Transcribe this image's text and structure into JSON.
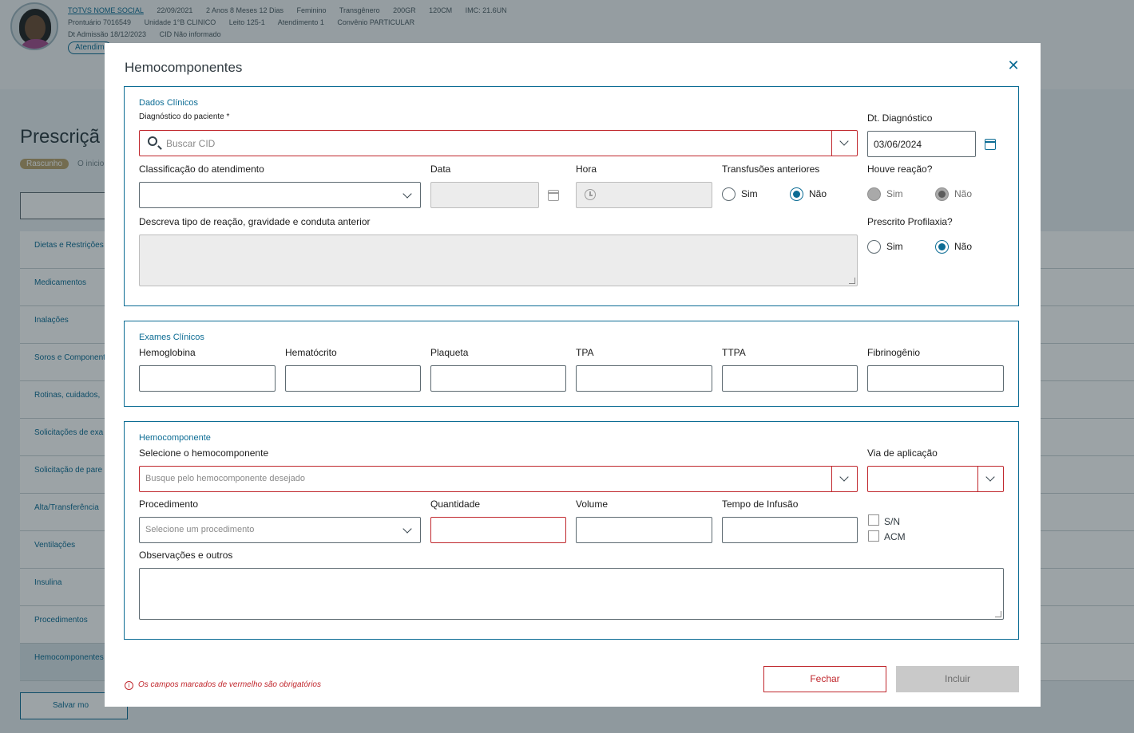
{
  "background": {
    "patient": {
      "name_link": "TOTVS NOME SOCIAL",
      "birth_date": "22/09/2021",
      "age": "2 Anos 8 Meses 12 Dias",
      "sex": "Feminino",
      "gender": "Transgênero",
      "weight": "200GR",
      "height": "120CM",
      "imc": "IMC: 21.6UN",
      "prontuario": "Prontuário 7016549",
      "unidade": "Unidade 1°B CLINICO",
      "leito": "Leito 125-1",
      "atendimento": "Atendimento 1",
      "convenio": "Convênio PARTICULAR",
      "admissao": "Dt Admissão 18/12/2023",
      "cid": "CID Não informado",
      "pill": "Atendim"
    },
    "page_title": "Prescriçã",
    "draft_badge": "Rascunho",
    "draft_note": "O inicio",
    "sidebar_items": [
      "Dietas e Restrições",
      "Medicamentos",
      "Inalações",
      "Soros e Componentes",
      "Rotinas, cuidados,",
      "Solicitações de exa",
      "Solicitação de pare",
      "Alta/Transferência",
      "Ventilações",
      "Insulina",
      "Procedimentos",
      "Hemocomponentes"
    ],
    "save_model": "Salvar mo"
  },
  "modal": {
    "title": "Hemocomponentes",
    "dados_clinicos": {
      "section_title": "Dados Clínicos",
      "diagnostico_label": "Diagnóstico do paciente *",
      "diagnostico_placeholder": "Buscar CID",
      "dt_diagnostico_label": "Dt. Diagnóstico",
      "dt_diagnostico_value": "03/06/2024",
      "classificacao_label": "Classificação do atendimento",
      "data_label": "Data",
      "hora_label": "Hora",
      "transfusoes_label": "Transfusões anteriores",
      "transfusoes_sim": "Sim",
      "transfusoes_nao": "Não",
      "houve_reacao_label": "Houve reação?",
      "houve_sim": "Sim",
      "houve_nao": "Não",
      "descreva_label": "Descreva tipo de reação, gravidade e conduta anterior",
      "profilaxia_label": "Prescrito Profilaxia?",
      "profilaxia_sim": "Sim",
      "profilaxia_nao": "Não"
    },
    "exames_clinicos": {
      "section_title": "Exames Clínicos",
      "fields": [
        "Hemoglobina",
        "Hematócrito",
        "Plaqueta",
        "TPA",
        "TTPA",
        "Fibrinogênio"
      ]
    },
    "hemocomponente": {
      "section_title": "Hemocomponente",
      "selecione_label": "Selecione o hemocomponente",
      "selecione_placeholder": "Busque pelo hemocomponente desejado",
      "via_label": "Via de aplicação",
      "procedimento_label": "Procedimento",
      "procedimento_placeholder": "Selecione um procedimento",
      "quantidade_label": "Quantidade",
      "volume_label": "Volume",
      "tempo_label": "Tempo de Infusão",
      "sn_label": "S/N",
      "acm_label": "ACM",
      "observacoes_label": "Observações e outros"
    },
    "footer_note": "Os campos marcados de vermelho são obrigatórios",
    "close_button": "Fechar",
    "include_button": "Incluir"
  }
}
